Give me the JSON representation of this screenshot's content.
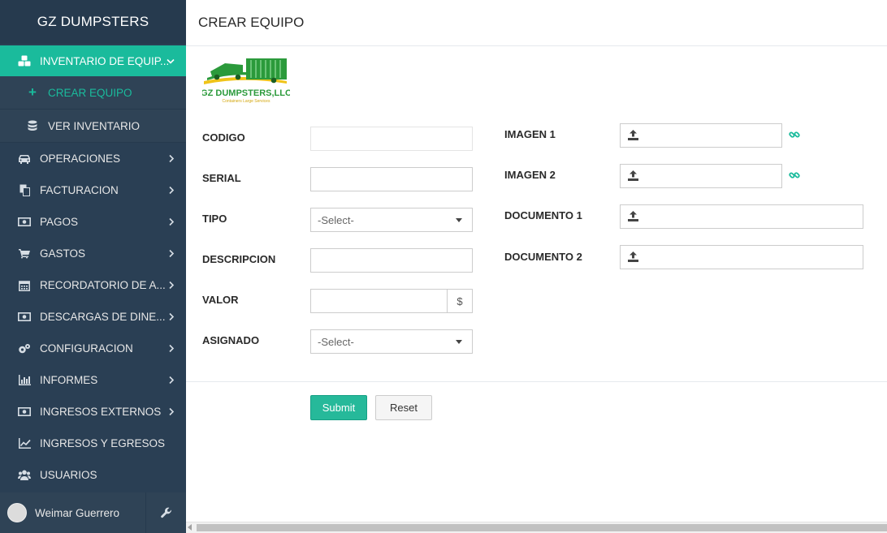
{
  "app": {
    "brand": "GZ DUMPSTERS"
  },
  "sidebar": {
    "items": [
      {
        "label": "INVENTARIO DE EQUIP...",
        "icon": "cubes-icon",
        "active": true,
        "sub": [
          {
            "label": "CREAR EQUIPO",
            "icon": "plus-icon"
          },
          {
            "label": "VER INVENTARIO",
            "icon": "database-icon"
          }
        ]
      },
      {
        "label": "OPERACIONES",
        "icon": "car-icon"
      },
      {
        "label": "FACTURACION",
        "icon": "copy-icon"
      },
      {
        "label": "PAGOS",
        "icon": "money-icon"
      },
      {
        "label": "GASTOS",
        "icon": "cart-icon"
      },
      {
        "label": "RECORDATORIO DE A...",
        "icon": "calendar-icon"
      },
      {
        "label": "DESCARGAS DE DINE...",
        "icon": "money-icon"
      },
      {
        "label": "CONFIGURACION",
        "icon": "gears-icon"
      },
      {
        "label": "INFORMES",
        "icon": "bar-chart-icon"
      },
      {
        "label": "INGRESOS EXTERNOS",
        "icon": "money-icon"
      },
      {
        "label": "INGRESOS Y EGRESOS",
        "icon": "line-chart-icon"
      },
      {
        "label": "USUARIOS",
        "icon": "users-icon"
      }
    ],
    "user": {
      "name": "Weimar Guerrero"
    }
  },
  "page": {
    "title": "CREAR EQUIPO",
    "logo": {
      "main": "GZ DUMPSTERS,LLC",
      "tagline": "Containers Large Services"
    },
    "left_fields": [
      {
        "label": "CODIGO",
        "value": ""
      },
      {
        "label": "SERIAL",
        "value": ""
      },
      {
        "label": "TIPO",
        "value": "-Select-"
      },
      {
        "label": "DESCRIPCION",
        "value": ""
      },
      {
        "label": "VALOR",
        "value": "",
        "addon": "$"
      },
      {
        "label": "ASIGNADO",
        "value": "-Select-"
      }
    ],
    "right_fields": [
      {
        "label": "IMAGEN 1"
      },
      {
        "label": "IMAGEN 2"
      },
      {
        "label": "DOCUMENTO 1"
      },
      {
        "label": "DOCUMENTO 2"
      }
    ],
    "buttons": {
      "submit": "Submit",
      "reset": "Reset"
    }
  },
  "colors": {
    "sidebar_bg": "#2a3f54",
    "accent": "#1abb9c",
    "submit": "#26b99a"
  }
}
